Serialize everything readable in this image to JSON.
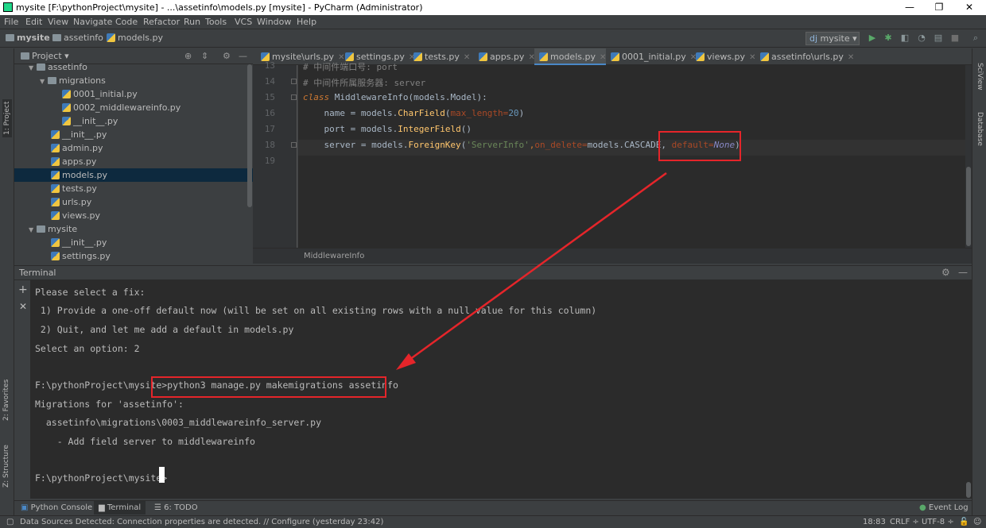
{
  "window": {
    "title": "mysite [F:\\pythonProject\\mysite] - ...\\assetinfo\\models.py [mysite] - PyCharm (Administrator)",
    "minimize": "—",
    "maximize": "❐",
    "close": "✕"
  },
  "menu": [
    "File",
    "Edit",
    "View",
    "Navigate",
    "Code",
    "Refactor",
    "Run",
    "Tools",
    "VCS",
    "Window",
    "Help"
  ],
  "breadcrumb": [
    "mysite",
    "assetinfo",
    "models.py"
  ],
  "run_config": "mysite",
  "left_strip": {
    "project": "1: Project",
    "favorites": "2: Favorites",
    "structure": "Z: Structure"
  },
  "right_strip": {
    "sciview": "SciView",
    "database": "Database"
  },
  "project_panel": {
    "header": "Project",
    "tree": [
      {
        "label": "assetinfo",
        "type": "folder",
        "depth": 1,
        "expanded": true
      },
      {
        "label": "migrations",
        "type": "folder",
        "depth": 2,
        "expanded": true
      },
      {
        "label": "0001_initial.py",
        "type": "py",
        "depth": 3
      },
      {
        "label": "0002_middlewareinfo.py",
        "type": "py",
        "depth": 3
      },
      {
        "label": "__init__.py",
        "type": "py",
        "depth": 3
      },
      {
        "label": "__init__.py",
        "type": "py",
        "depth": 2
      },
      {
        "label": "admin.py",
        "type": "py",
        "depth": 2
      },
      {
        "label": "apps.py",
        "type": "py",
        "depth": 2
      },
      {
        "label": "models.py",
        "type": "py",
        "depth": 2,
        "selected": true
      },
      {
        "label": "tests.py",
        "type": "py",
        "depth": 2
      },
      {
        "label": "urls.py",
        "type": "py",
        "depth": 2
      },
      {
        "label": "views.py",
        "type": "py",
        "depth": 2
      },
      {
        "label": "mysite",
        "type": "folder",
        "depth": 1,
        "expanded": true
      },
      {
        "label": "__init__.py",
        "type": "py",
        "depth": 2
      },
      {
        "label": "settings.py",
        "type": "py",
        "depth": 2
      }
    ]
  },
  "tabs": [
    {
      "label": "mysite\\urls.py",
      "active": false
    },
    {
      "label": "settings.py",
      "active": false
    },
    {
      "label": "tests.py",
      "active": false
    },
    {
      "label": "apps.py",
      "active": false
    },
    {
      "label": "models.py",
      "active": true
    },
    {
      "label": "0001_initial.py",
      "active": false
    },
    {
      "label": "views.py",
      "active": false
    },
    {
      "label": "assetinfo\\urls.py",
      "active": false
    }
  ],
  "editor": {
    "line_numbers": [
      "13",
      "14",
      "15",
      "16",
      "17",
      "18",
      "19"
    ],
    "line13": "# 中间件端口号: port",
    "line14": "# 中间件所属服务器: server",
    "line15": {
      "kw": "class",
      "name": "MiddlewareInfo",
      "rest": "(models.Model):"
    },
    "line16": {
      "a": "    name = models.",
      "fn": "CharField",
      "b": "(",
      "p": "max_length=",
      "n": "20",
      "c": ")"
    },
    "line17": {
      "a": "    port = models.",
      "fn": "IntegerField",
      "b": "()"
    },
    "line18": {
      "a": "    server = models.",
      "fn": "ForeignKey",
      "b": "(",
      "s": "'ServerInfo'",
      "c": ",",
      "p": "on_delete=",
      "d": "models.CASCADE, ",
      "p2": "default=",
      "nv": "None",
      "e": ")"
    },
    "breadcrumb": "MiddlewareInfo"
  },
  "terminal": {
    "title": "Terminal",
    "lines": [
      "Please select a fix:",
      " 1) Provide a one-off default now (will be set on all existing rows with a null value for this column)",
      " 2) Quit, and let me add a default in models.py",
      "Select an option: 2",
      "",
      "F:\\pythonProject\\mysite>python3 manage.py makemigrations assetinfo",
      "Migrations for 'assetinfo':",
      "  assetinfo\\migrations\\0003_middlewareinfo_server.py",
      "    - Add field server to middlewareinfo",
      "",
      "F:\\pythonProject\\mysite>"
    ]
  },
  "bottom_tabs": [
    "Python Console",
    "Terminal",
    "6: TODO"
  ],
  "event_log": "Event Log",
  "status": {
    "message": "Data Sources Detected: Connection properties are detected. // Configure (yesterday 23:42)",
    "position": "18:83",
    "line_sep": "CRLF ÷",
    "encoding": "UTF-8 ÷"
  }
}
